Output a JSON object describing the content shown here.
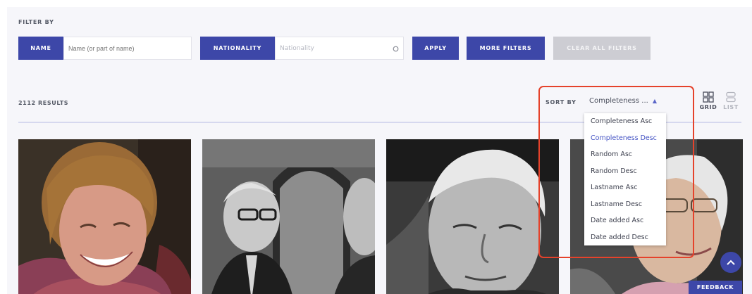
{
  "filters": {
    "heading": "FILTER BY",
    "name_label": "NAME",
    "name_placeholder": "Name (or part of name)",
    "nationality_label": "NATIONALITY",
    "nationality_placeholder": "Nationality",
    "apply": "APPLY",
    "more_filters": "MORE FILTERS",
    "clear_all": "CLEAR ALL FILTERS"
  },
  "results": {
    "count_label": "2112 RESULTS",
    "sort_label": "SORT BY",
    "sort_value": "Completeness ...",
    "sort_options": [
      "Completeness Asc",
      "Completeness Desc",
      "Random Asc",
      "Random Desc",
      "Lastname Asc",
      "Lastname Desc",
      "Date added Asc",
      "Date added Desc"
    ],
    "selected_option": "Completeness Desc"
  },
  "views": {
    "grid": "GRID",
    "list": "LIST",
    "active": "GRID"
  },
  "feedback": "FEEDBACK",
  "colors": {
    "accent": "#3d47a8",
    "highlight": "#e5422b",
    "active_option": "#4453c4"
  }
}
